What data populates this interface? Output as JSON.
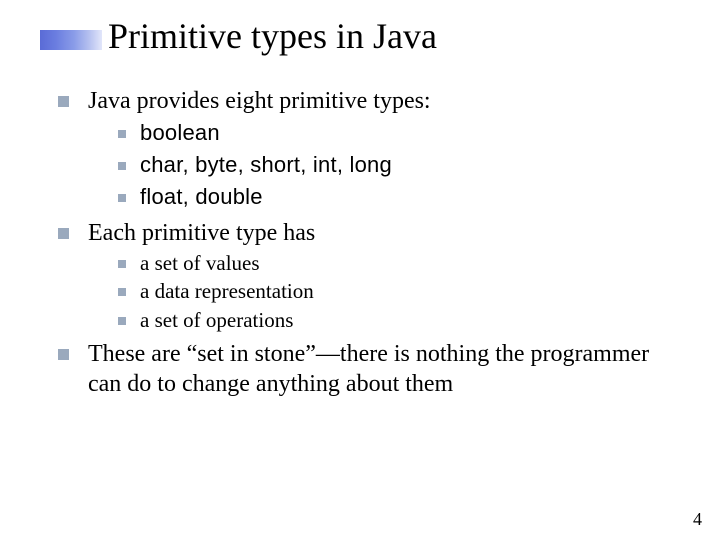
{
  "title": "Primitive types in Java",
  "bullets": {
    "b1": {
      "text": "Java provides eight primitive types:",
      "sub": {
        "s1": "boolean",
        "s2": "char, byte, short, int, long",
        "s3": "float, double"
      }
    },
    "b2": {
      "text": "Each primitive type has",
      "sub": {
        "s1": "a set of values",
        "s2": "a data representation",
        "s3": "a set of operations"
      }
    },
    "b3": {
      "text": "These are “set in stone”—there is nothing the programmer can do to change anything about them"
    }
  },
  "page_number": "4"
}
